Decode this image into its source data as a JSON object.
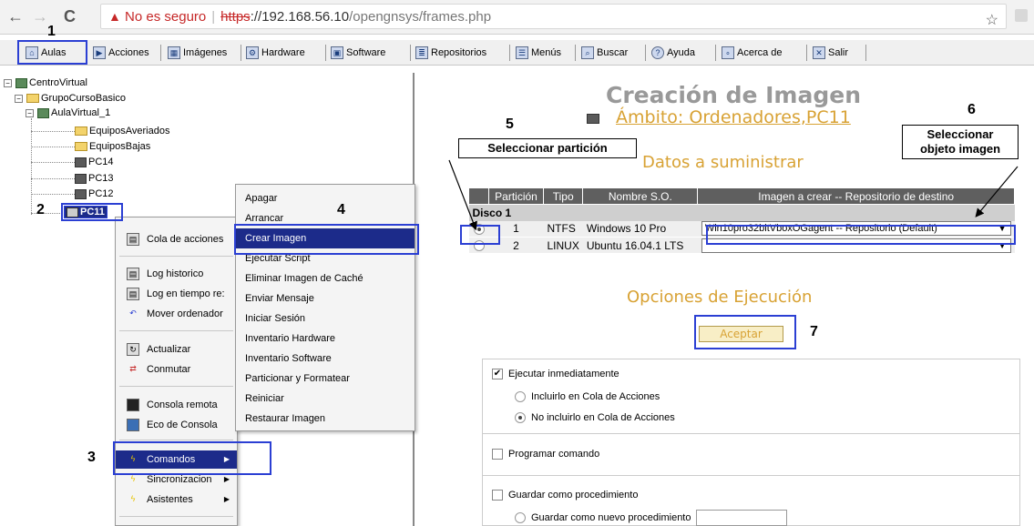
{
  "browser": {
    "back": "←",
    "forward": "→",
    "reload": "C",
    "insecure_label": "No es seguro",
    "scheme": "https",
    "url_rest_host": "://192.168.56.10",
    "url_path": "/opengnsys/frames.php",
    "star": "☆"
  },
  "toolbar": {
    "items": [
      {
        "label": "Aulas",
        "icon": "classroom-icon"
      },
      {
        "label": "Acciones",
        "icon": "actions-icon"
      },
      {
        "label": "Imágenes",
        "icon": "images-icon"
      },
      {
        "label": "Hardware",
        "icon": "hardware-icon"
      },
      {
        "label": "Software",
        "icon": "software-icon"
      },
      {
        "label": "Repositorios",
        "icon": "repositories-icon"
      },
      {
        "label": "Menús",
        "icon": "menus-icon"
      },
      {
        "label": "Buscar",
        "icon": "search-icon"
      },
      {
        "label": "Ayuda",
        "icon": "help-icon"
      },
      {
        "label": "Acerca de",
        "icon": "about-icon"
      },
      {
        "label": "Salir",
        "icon": "exit-icon"
      }
    ]
  },
  "tree": {
    "root": "CentroVirtual",
    "group": "GrupoCursoBasico",
    "classroom": "AulaVirtual_1",
    "folders": [
      "EquiposAveriados",
      "EquiposBajas"
    ],
    "pcs": [
      "PC14",
      "PC13",
      "PC12",
      "PC11"
    ]
  },
  "context_menu": {
    "items": [
      "Cola de acciones",
      "Log historico",
      "Log en tiempo re:",
      "Mover ordenador",
      "Actualizar",
      "Conmutar",
      "Consola remota",
      "Eco de Consola",
      "Comandos",
      "Sincronizacion",
      "Asistentes"
    ]
  },
  "submenu": {
    "items": [
      "Apagar",
      "Arrancar",
      "Crear Imagen",
      "Ejecutar Script",
      "Eliminar Imagen de Caché",
      "Enviar Mensaje",
      "Iniciar Sesión",
      "Inventario Hardware",
      "Inventario Software",
      "Particionar y Formatear",
      "Reiniciar",
      "Restaurar Imagen"
    ]
  },
  "annotations": {
    "n1": "1",
    "n2": "2",
    "n3": "3",
    "n4": "4",
    "n5": "5",
    "n6": "6",
    "n7": "7",
    "callout_partition": "Seleccionar partición",
    "callout_image_line1": "Seleccionar",
    "callout_image_line2": "objeto imagen"
  },
  "main": {
    "title": "Creación de Imagen",
    "ambito": "Ámbito: Ordenadores,PC11",
    "datos_title": "Datos a suministrar",
    "table_headers": [
      "",
      "Partición",
      "Tipo",
      "Nombre S.O.",
      "Imagen a crear -- Repositorio de destino"
    ],
    "disk_label": "Disco 1",
    "rows": [
      {
        "partition": "1",
        "type": "NTFS",
        "os": "Windows 10 Pro",
        "image": "Win10pro32bitVboxOGagent -- Repositorio (Default)",
        "selected": true
      },
      {
        "partition": "2",
        "type": "LINUX",
        "os": "Ubuntu 16.04.1 LTS",
        "image": "",
        "selected": false
      }
    ],
    "opciones_title": "Opciones de Ejecución",
    "accept_label": "Aceptar",
    "opt_execute_now": "Ejecutar inmediatamente",
    "opt_include_queue": "Incluirlo en Cola de Acciones",
    "opt_not_include_queue": "No incluirlo en Cola de Acciones",
    "opt_schedule": "Programar comando",
    "opt_save_proc": "Guardar como procedimiento",
    "opt_save_new_proc": "Guardar como nuevo procedimiento"
  },
  "colors": {
    "accent_blue": "#2b3fd3",
    "highlight": "#1c2b8a",
    "title_orange": "#d8a234",
    "insecure_red": "#c62828"
  }
}
